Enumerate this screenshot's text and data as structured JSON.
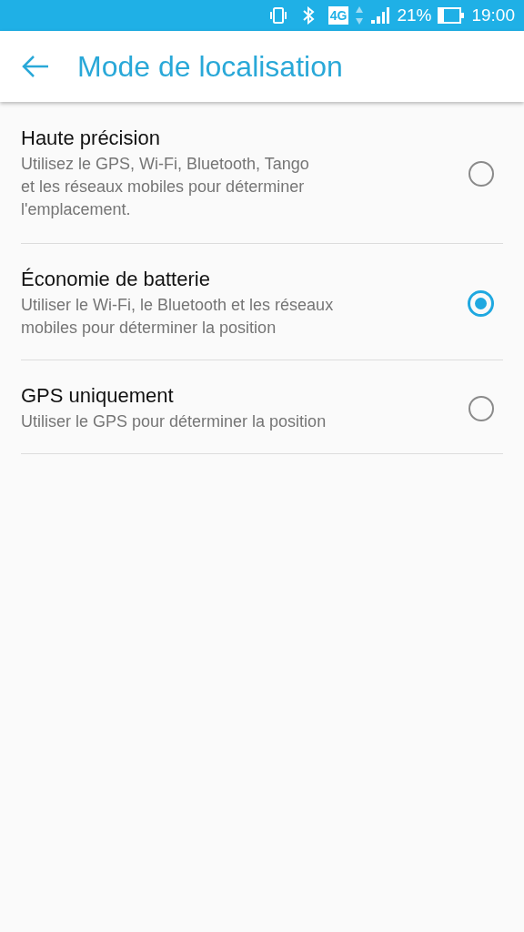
{
  "status_bar": {
    "network": "4G",
    "battery": "21%",
    "time": "19:00"
  },
  "header": {
    "title": "Mode de localisation"
  },
  "options": [
    {
      "title": "Haute précision",
      "description": [
        "Utilisez le GPS, Wi-Fi, Bluetooth, Tango",
        "et les réseaux mobiles pour déterminer",
        "l'emplacement."
      ],
      "selected": false
    },
    {
      "title": "Économie de batterie",
      "description": [
        "Utiliser le Wi-Fi, le Bluetooth et les réseaux",
        "mobiles pour déterminer la position"
      ],
      "selected": true
    },
    {
      "title": "GPS uniquement",
      "description": [
        "Utiliser le GPS pour déterminer la position"
      ],
      "selected": false
    }
  ]
}
